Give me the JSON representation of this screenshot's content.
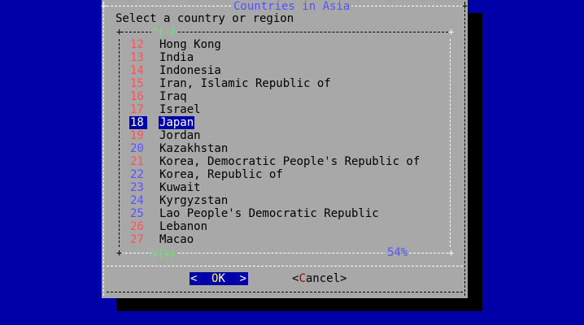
{
  "dialog": {
    "title": "Countries in Asia",
    "prompt": "Select a country or region",
    "scroll_up_indicator": "^(-)",
    "scroll_down_indicator": "v(+)",
    "scroll_percent": "54%"
  },
  "list": {
    "items": [
      {
        "num": "12",
        "label": "Hong Kong",
        "num_color": "red"
      },
      {
        "num": "13",
        "label": "India",
        "num_color": "red"
      },
      {
        "num": "14",
        "label": "Indonesia",
        "num_color": "red"
      },
      {
        "num": "15",
        "label": "Iran, Islamic Republic of",
        "num_color": "red"
      },
      {
        "num": "16",
        "label": "Iraq",
        "num_color": "red"
      },
      {
        "num": "17",
        "label": "Israel",
        "num_color": "red"
      },
      {
        "num": "18",
        "label": "Japan",
        "num_color": "red",
        "selected": true
      },
      {
        "num": "19",
        "label": "Jordan",
        "num_color": "red"
      },
      {
        "num": "20",
        "label": "Kazakhstan",
        "num_color": "blue"
      },
      {
        "num": "21",
        "label": "Korea, Democratic People's Republic of",
        "num_color": "red"
      },
      {
        "num": "22",
        "label": "Korea, Republic of",
        "num_color": "blue"
      },
      {
        "num": "23",
        "label": "Kuwait",
        "num_color": "blue"
      },
      {
        "num": "24",
        "label": "Kyrgyzstan",
        "num_color": "blue"
      },
      {
        "num": "25",
        "label": "Lao People's Democratic Republic",
        "num_color": "blue"
      },
      {
        "num": "26",
        "label": "Lebanon",
        "num_color": "red"
      },
      {
        "num": "27",
        "label": "Macao",
        "num_color": "red"
      }
    ]
  },
  "buttons": {
    "ok": {
      "left": "<",
      "hotkey": "O",
      "rest": "K",
      "right": ">"
    },
    "cancel": {
      "left": "<",
      "hotkey": "C",
      "rest": "ancel",
      "right": ">"
    }
  },
  "colors": {
    "background": "#0000a8",
    "dialog": "#a8a8a8",
    "title": "#5454fc",
    "number_red": "#fc5454",
    "number_blue": "#5454fc",
    "selection": "#0000a8",
    "scroll_indicator": "#54fc54",
    "hotkey_cancel": "#a80000",
    "hotkey_ok": "#fcfc54"
  }
}
